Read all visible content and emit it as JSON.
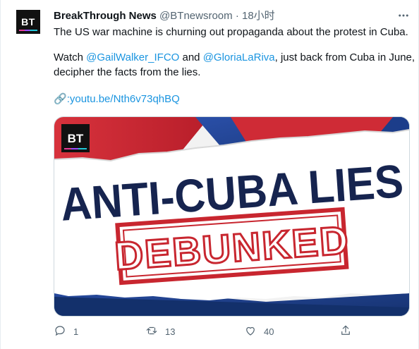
{
  "author": {
    "avatar_text": "BT",
    "name": "BreakThrough News",
    "handle": "@BTnewsroom",
    "separator": "·",
    "time": "18小时"
  },
  "tweet": {
    "line1": "The US war machine is churning out propaganda about the protest in Cuba.",
    "line2_prefix": "Watch ",
    "mention1": "@GailWalker_IFCO",
    "line2_and": " and ",
    "mention2": "@GloriaLaRiva",
    "line2_suffix": ", just back from Cuba in June,",
    "line3": "decipher the facts from the lies.",
    "link_icon": "🔗",
    "link_text": ":youtu.be/Nth6v73qhBQ"
  },
  "media": {
    "logo_text": "BT",
    "headline": "ANTI-CUBA LIES",
    "stamp": "DEBUNKED"
  },
  "actions": {
    "reply_count": "1",
    "retweet_count": "13",
    "like_count": "40"
  },
  "colors": {
    "link": "#1b95e0",
    "flag_red": "#c8202f",
    "flag_blue": "#1f3f8f",
    "headline": "#16244f",
    "stamp": "#c8262f"
  }
}
